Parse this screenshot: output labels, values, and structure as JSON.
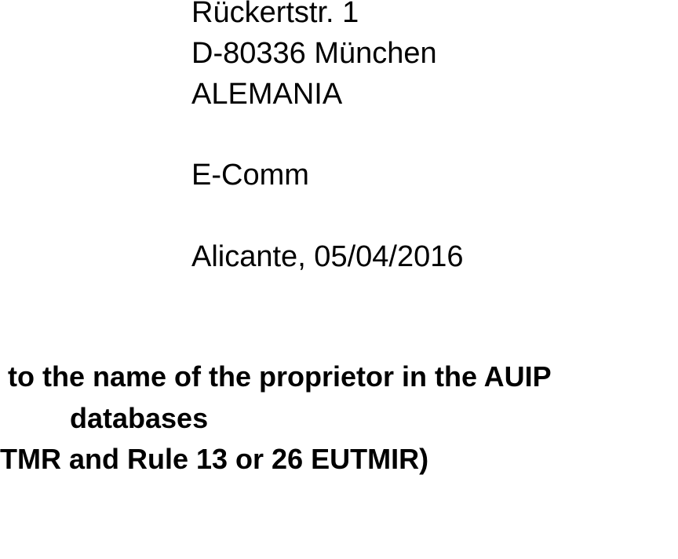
{
  "address": {
    "street": "Rückertstr. 1",
    "city": "D-80336 München",
    "country": "ALEMANIA"
  },
  "channel": "E-Comm",
  "place_date": "Alicante, 05/04/2016",
  "subject": {
    "line1": "to the name of the proprietor in the AUIP",
    "line2": "databases",
    "line3": "TMR and Rule 13 or 26 EUTMIR)"
  }
}
